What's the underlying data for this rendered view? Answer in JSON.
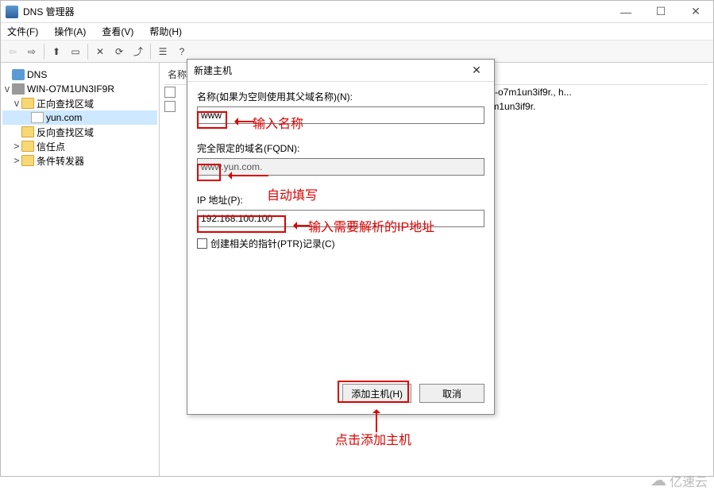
{
  "window": {
    "title": "DNS 管理器",
    "menus": {
      "file": "文件(F)",
      "action": "操作(A)",
      "view": "查看(V)",
      "help": "帮助(H)"
    }
  },
  "tree": {
    "root": "DNS",
    "server": "WIN-O7M1UN3IF9R",
    "fwd_zone": "正向查找区域",
    "domain": "yun.com",
    "rev_zone": "反向查找区域",
    "trust": "信任点",
    "cond_fwd": "条件转发器"
  },
  "list": {
    "header_name": "名称",
    "row1": {
      "data": "win-o7m1un3if9r., h..."
    },
    "row2": {
      "data": "o7m1un3if9r."
    }
  },
  "dialog": {
    "title": "新建主机",
    "name_label": "名称(如果为空则使用其父域名称)(N):",
    "name_value": "www",
    "fqdn_label": "完全限定的域名(FQDN):",
    "fqdn_value": "www.yun.com.",
    "ip_label": "IP 地址(P):",
    "ip_value": "192.168.100.100",
    "ptr_label": "创建相关的指针(PTR)记录(C)",
    "add_btn": "添加主机(H)",
    "cancel_btn": "取消"
  },
  "annotations": {
    "name_hint": "输入名称",
    "fqdn_hint": "自动填写",
    "ip_hint": "输入需要解析的IP地址",
    "add_hint": "点击添加主机"
  },
  "watermark": "亿速云"
}
